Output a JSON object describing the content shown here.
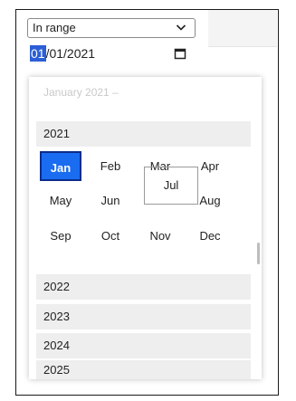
{
  "filter": {
    "operator": "In range",
    "date_day": "01",
    "date_rest": "/01/2021"
  },
  "calendar": {
    "header": "January 2021 –",
    "years": [
      "2021",
      "2022",
      "2023",
      "2024",
      "2025"
    ],
    "months": [
      "Jan",
      "Feb",
      "Mar",
      "Apr",
      "May",
      "Jun",
      "Jul",
      "Aug",
      "Sep",
      "Oct",
      "Nov",
      "Dec"
    ],
    "selected_month": "Jan",
    "current_month": "Jul"
  },
  "colors": {
    "selected_bg": "#1a6cf0",
    "selected_border": "#0c2c8a",
    "segment_highlight": "#2c5fd6"
  }
}
